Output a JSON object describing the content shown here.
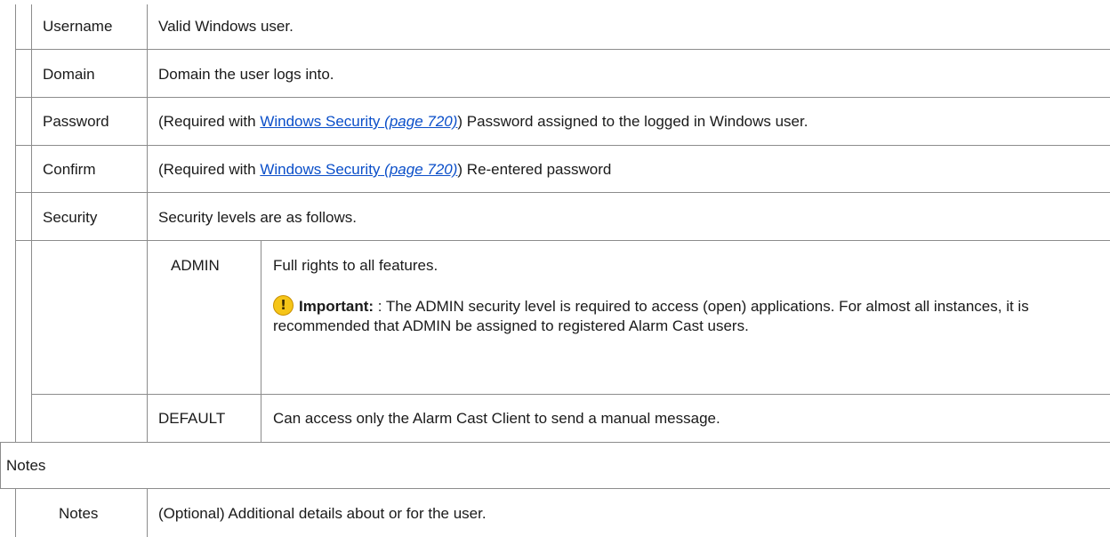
{
  "rows": [
    {
      "label": "Username",
      "description": "Valid Windows user."
    },
    {
      "label": "Domain",
      "description": "Domain the user logs into."
    },
    {
      "label": "Password",
      "prefix": "(Required with ",
      "link_text": "Windows Security",
      "link_page": "(page 720)",
      "suffix": ") Password assigned to the logged in Windows user."
    },
    {
      "label": "Confirm",
      "prefix": "(Required with ",
      "link_text": "Windows Security",
      "link_page": "(page 720)",
      "suffix": ") Re-entered password"
    },
    {
      "label": "Security",
      "description": "Security levels are as follows."
    }
  ],
  "security_levels": [
    {
      "level": "ADMIN",
      "description": "Full rights to all features.",
      "note": {
        "icon": "warning-icon",
        "icon_glyph": "!",
        "icon_color": "#f5c518",
        "label": "Important:",
        "text": " : The ADMIN security level is required to access (open) applications. For almost all instances, it is recommended that ADMIN be assigned to registered Alarm Cast users."
      }
    },
    {
      "level": "DEFAULT",
      "description": "Can access only the Alarm Cast Client to send a manual message."
    }
  ],
  "notes_section": {
    "heading": "Notes",
    "label": "Notes",
    "description": "(Optional) Additional details about or for the user."
  },
  "colors": {
    "link": "#0b4fc9",
    "border": "#8c8c8c",
    "text": "#1a1a1a"
  }
}
